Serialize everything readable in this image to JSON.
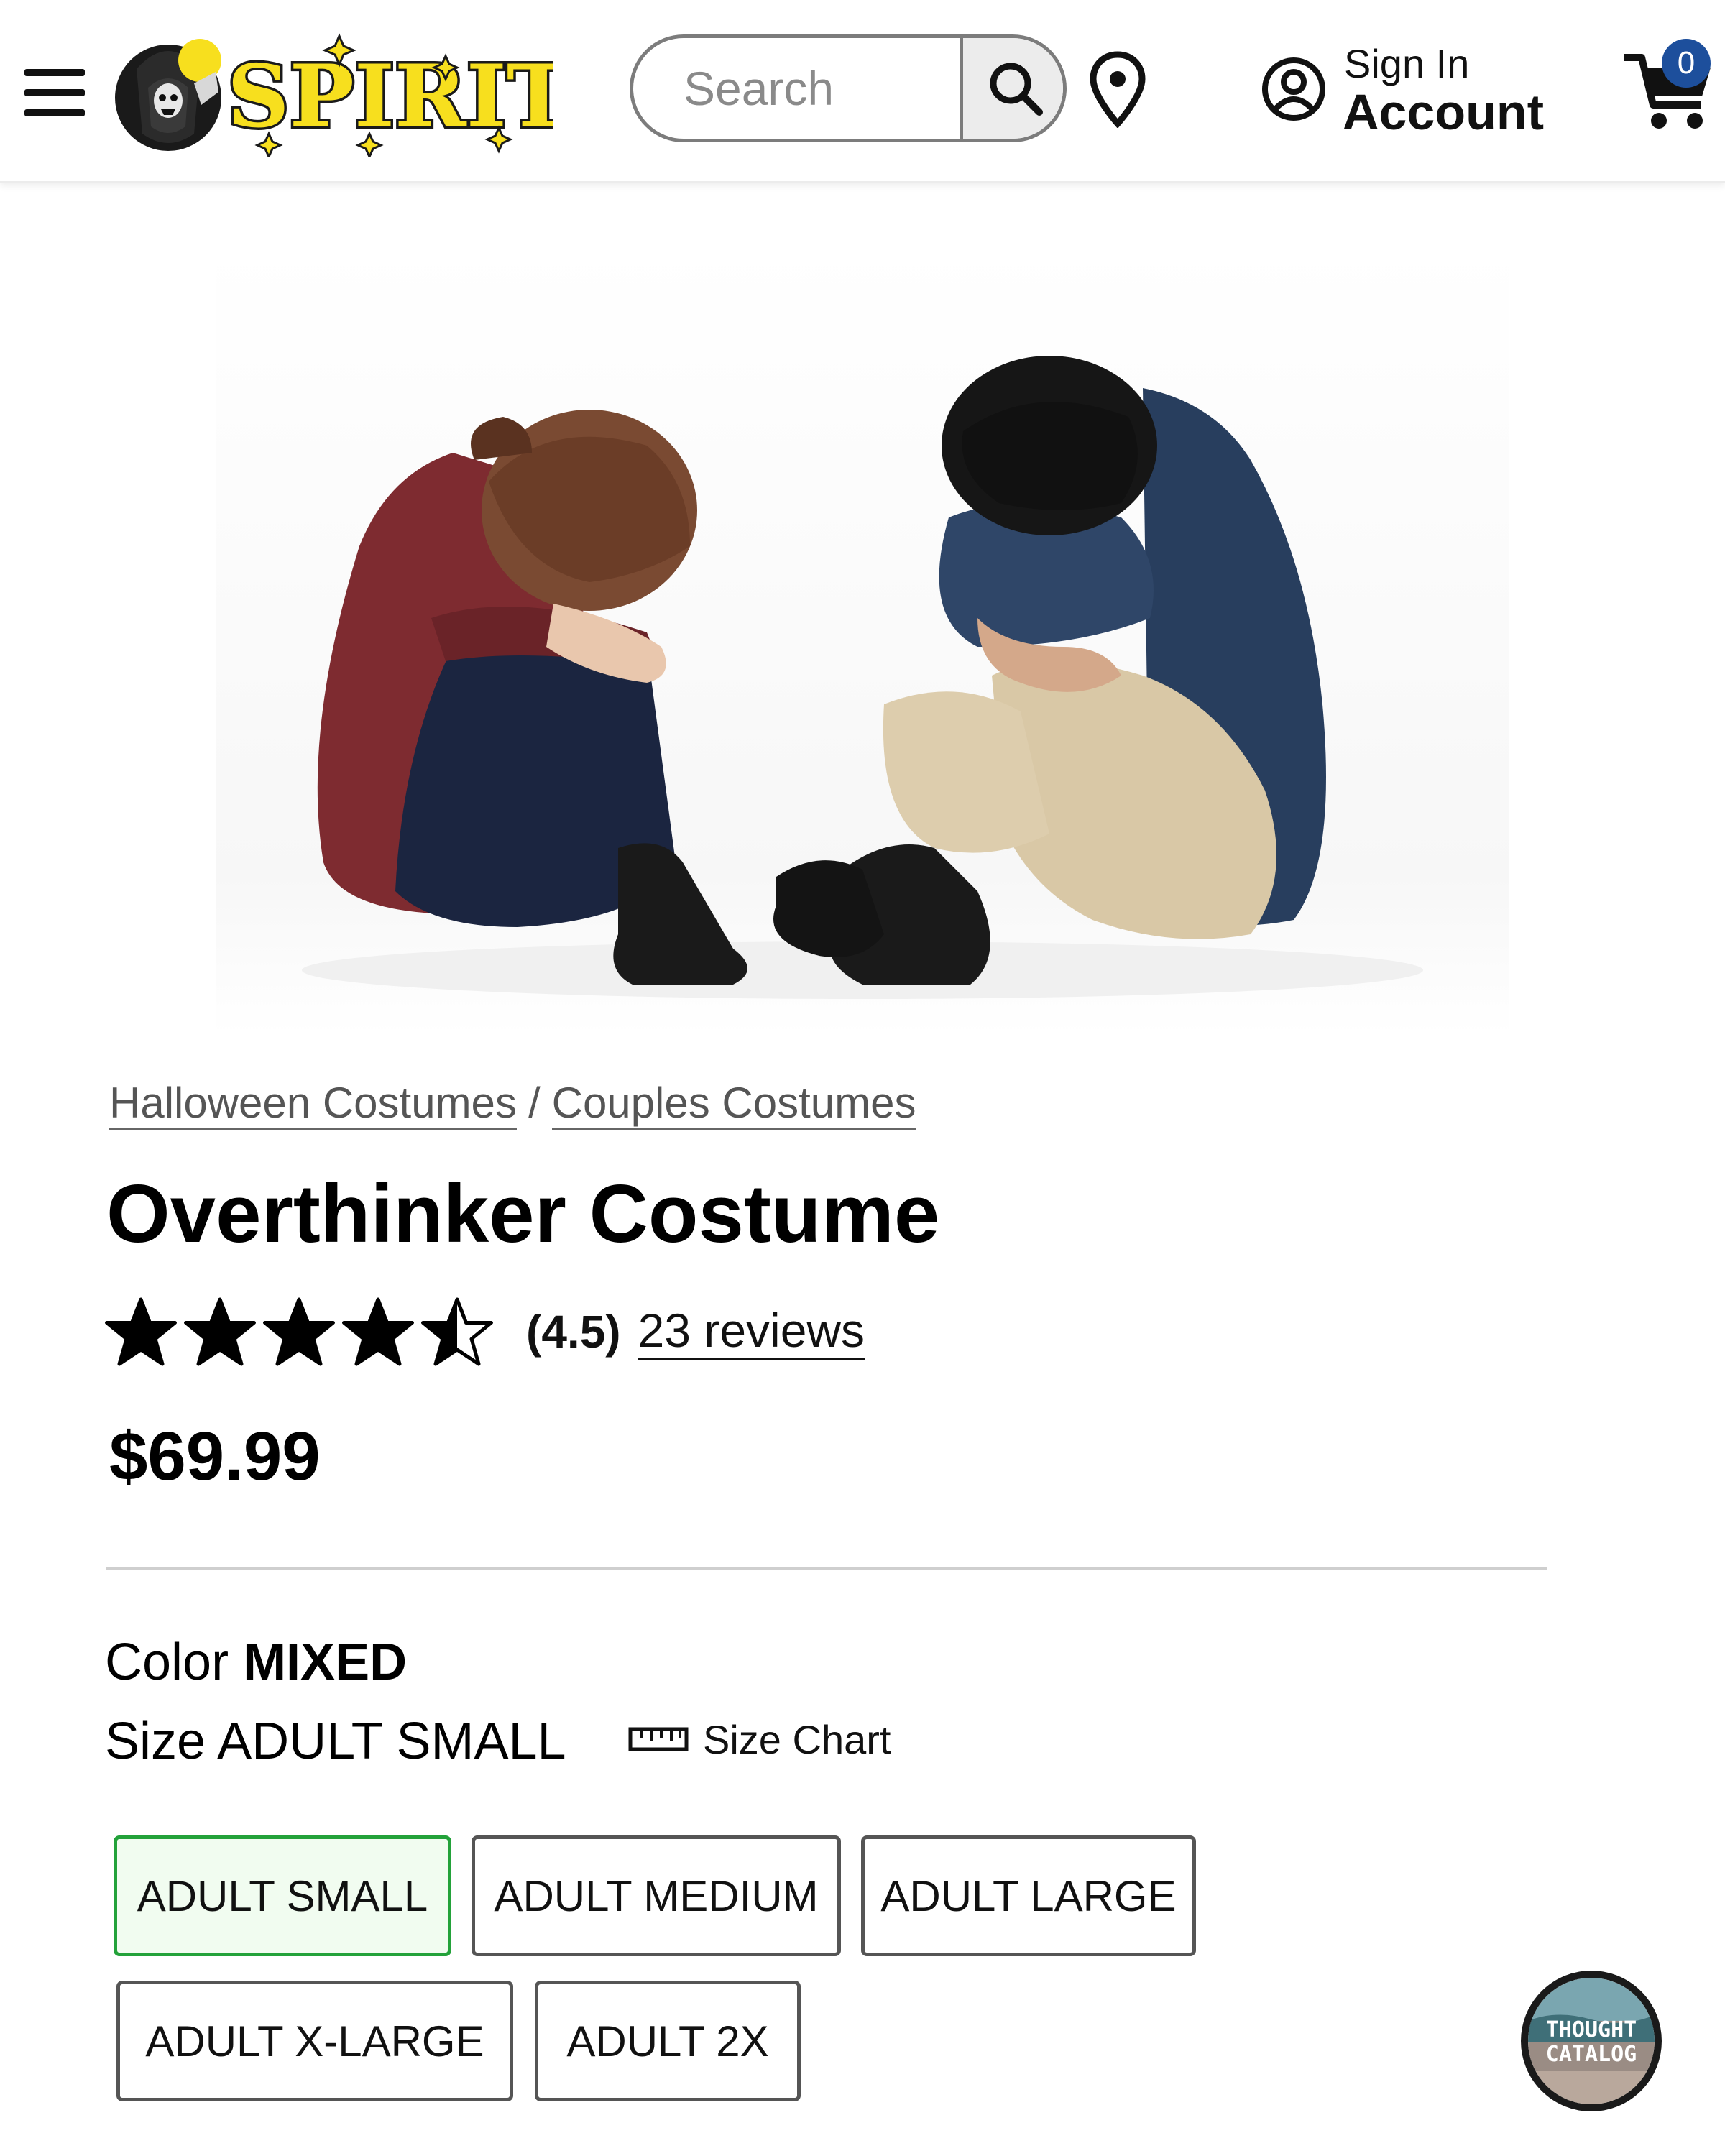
{
  "header": {
    "menu_icon": "hamburger-menu-icon",
    "logo_text": "SPIRIT",
    "search": {
      "placeholder": "Search",
      "value": ""
    },
    "search_icon": "search-icon",
    "store_icon": "location-pin-icon",
    "account": {
      "line1": "Sign In",
      "line2": "Account",
      "icon": "user-circle-icon"
    },
    "cart": {
      "count": "0",
      "icon": "shopping-cart-icon"
    }
  },
  "breadcrumb": [
    {
      "label": "Halloween Costumes"
    },
    {
      "label": "Couples Costumes"
    }
  ],
  "breadcrumb_separator": "/",
  "product": {
    "title": "Overthinker Costume",
    "rating_value": "(4.5)",
    "rating": 4.5,
    "rating_max": 5,
    "reviews": "23 reviews",
    "price": "$69.99"
  },
  "options": {
    "color_label": "Color",
    "color_value": "MIXED",
    "size_label": "Size",
    "size_value": "ADULT SMALL",
    "size_chart_label": "Size Chart",
    "size_chart_icon": "ruler-icon",
    "sizes": [
      {
        "label": "ADULT SMALL",
        "selected": true
      },
      {
        "label": "ADULT MEDIUM",
        "selected": false
      },
      {
        "label": "ADULT LARGE",
        "selected": false
      },
      {
        "label": "ADULT X-LARGE",
        "selected": false
      },
      {
        "label": "ADULT 2X",
        "selected": false
      }
    ]
  },
  "watermark": {
    "line1": "THOUGHT",
    "line2": "CATALOG"
  },
  "colors": {
    "selected_border": "#23a23a",
    "selected_fill": "#f1fcf0",
    "cart_badge": "#1d4f9c",
    "logo_yellow": "#f7df1e"
  }
}
